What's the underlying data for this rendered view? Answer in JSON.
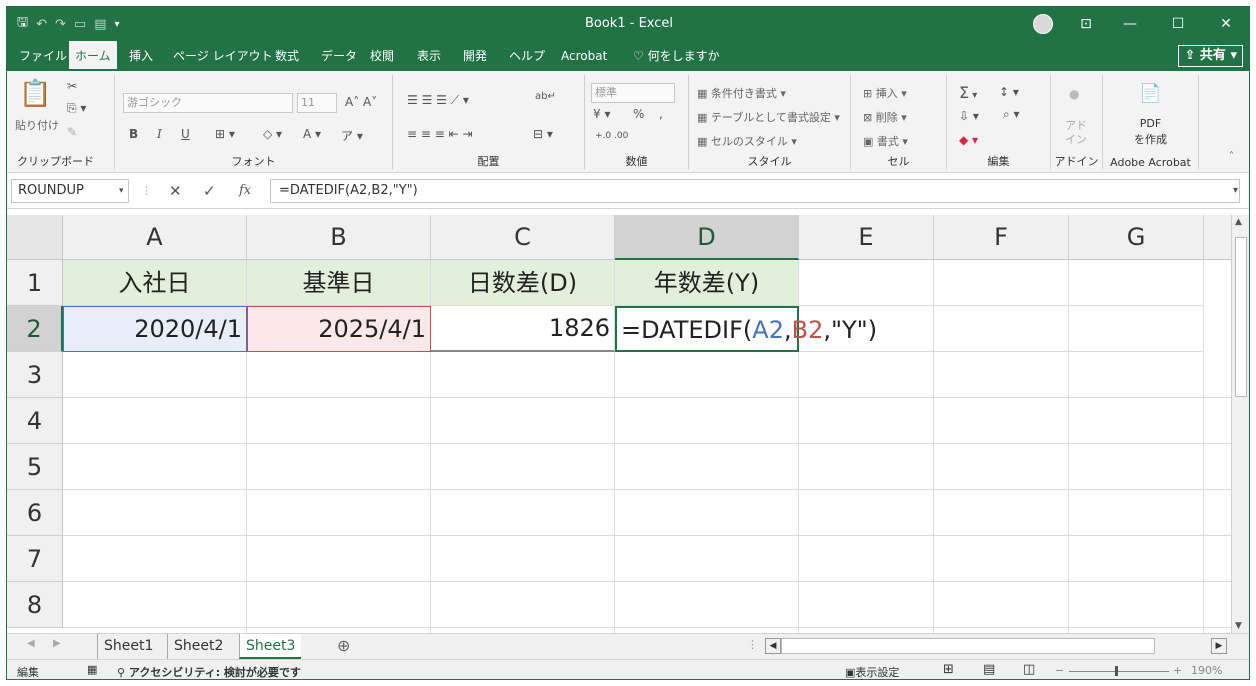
{
  "title_bar": {
    "title": "Book1 - Excel"
  },
  "menu": {
    "tabs": [
      "ファイル",
      "ホーム",
      "挿入",
      "ページ レイアウト",
      "数式",
      "データ",
      "校閲",
      "表示",
      "開発",
      "ヘルプ",
      "Acrobat"
    ],
    "search": "何をしますか",
    "share": "共有"
  },
  "ribbon": {
    "clipboard": {
      "paste": "貼り付け",
      "label": "クリップボード"
    },
    "font": {
      "name": "游ゴシック",
      "size": "11",
      "bold": "B",
      "italic": "I",
      "underline": "U",
      "label": "フォント"
    },
    "alignment": {
      "label": "配置"
    },
    "number": {
      "format": "標準",
      "percent": "%",
      "label": "数値"
    },
    "styles": {
      "conditional": "条件付き書式",
      "table": "テーブルとして書式設定",
      "cell": "セルのスタイル",
      "label": "スタイル"
    },
    "cells": {
      "insert": "挿入",
      "delete": "削除",
      "format": "書式",
      "label": "セル"
    },
    "editing": {
      "sum": "Σ",
      "label": "編集"
    },
    "addins": {
      "name": "アド\nイン",
      "label": "アドイン"
    },
    "acrobat": {
      "pdf": "PDF",
      "create": "を作成",
      "label": "Adobe Acrobat"
    }
  },
  "formula_bar": {
    "name_box": "ROUNDUP",
    "cancel": "✕",
    "enter": "✓",
    "fx": "fx",
    "formula": "=DATEDIF(A2,B2,\"Y\")"
  },
  "columns": [
    "A",
    "B",
    "C",
    "D",
    "E",
    "F",
    "G"
  ],
  "rows": [
    "1",
    "2",
    "3",
    "4",
    "5",
    "6",
    "7",
    "8"
  ],
  "cells": {
    "A1": "入社日",
    "B1": "基準日",
    "C1": "日数差(D)",
    "D1": "年数差(Y)",
    "A2": "2020/4/1",
    "B2": "2025/4/1",
    "C2": "1826",
    "D2": {
      "prefix": "=DATEDIF(",
      "ref1": "A2",
      "sep": ",",
      "ref2": "B2",
      "suffix": ",\"Y\")"
    }
  },
  "sheets": [
    "Sheet1",
    "Sheet2",
    "Sheet3"
  ],
  "active_sheet": "Sheet3",
  "status": {
    "mode": "編集",
    "accessibility": "アクセシビリティ: 検討が必要です",
    "display_settings": "表示設定",
    "zoom": "190%"
  },
  "colors": {
    "excel_green": "#217346",
    "header_fill": "#e2efda",
    "ref_blue": "#4472c4",
    "ref_red": "#c0504d"
  }
}
